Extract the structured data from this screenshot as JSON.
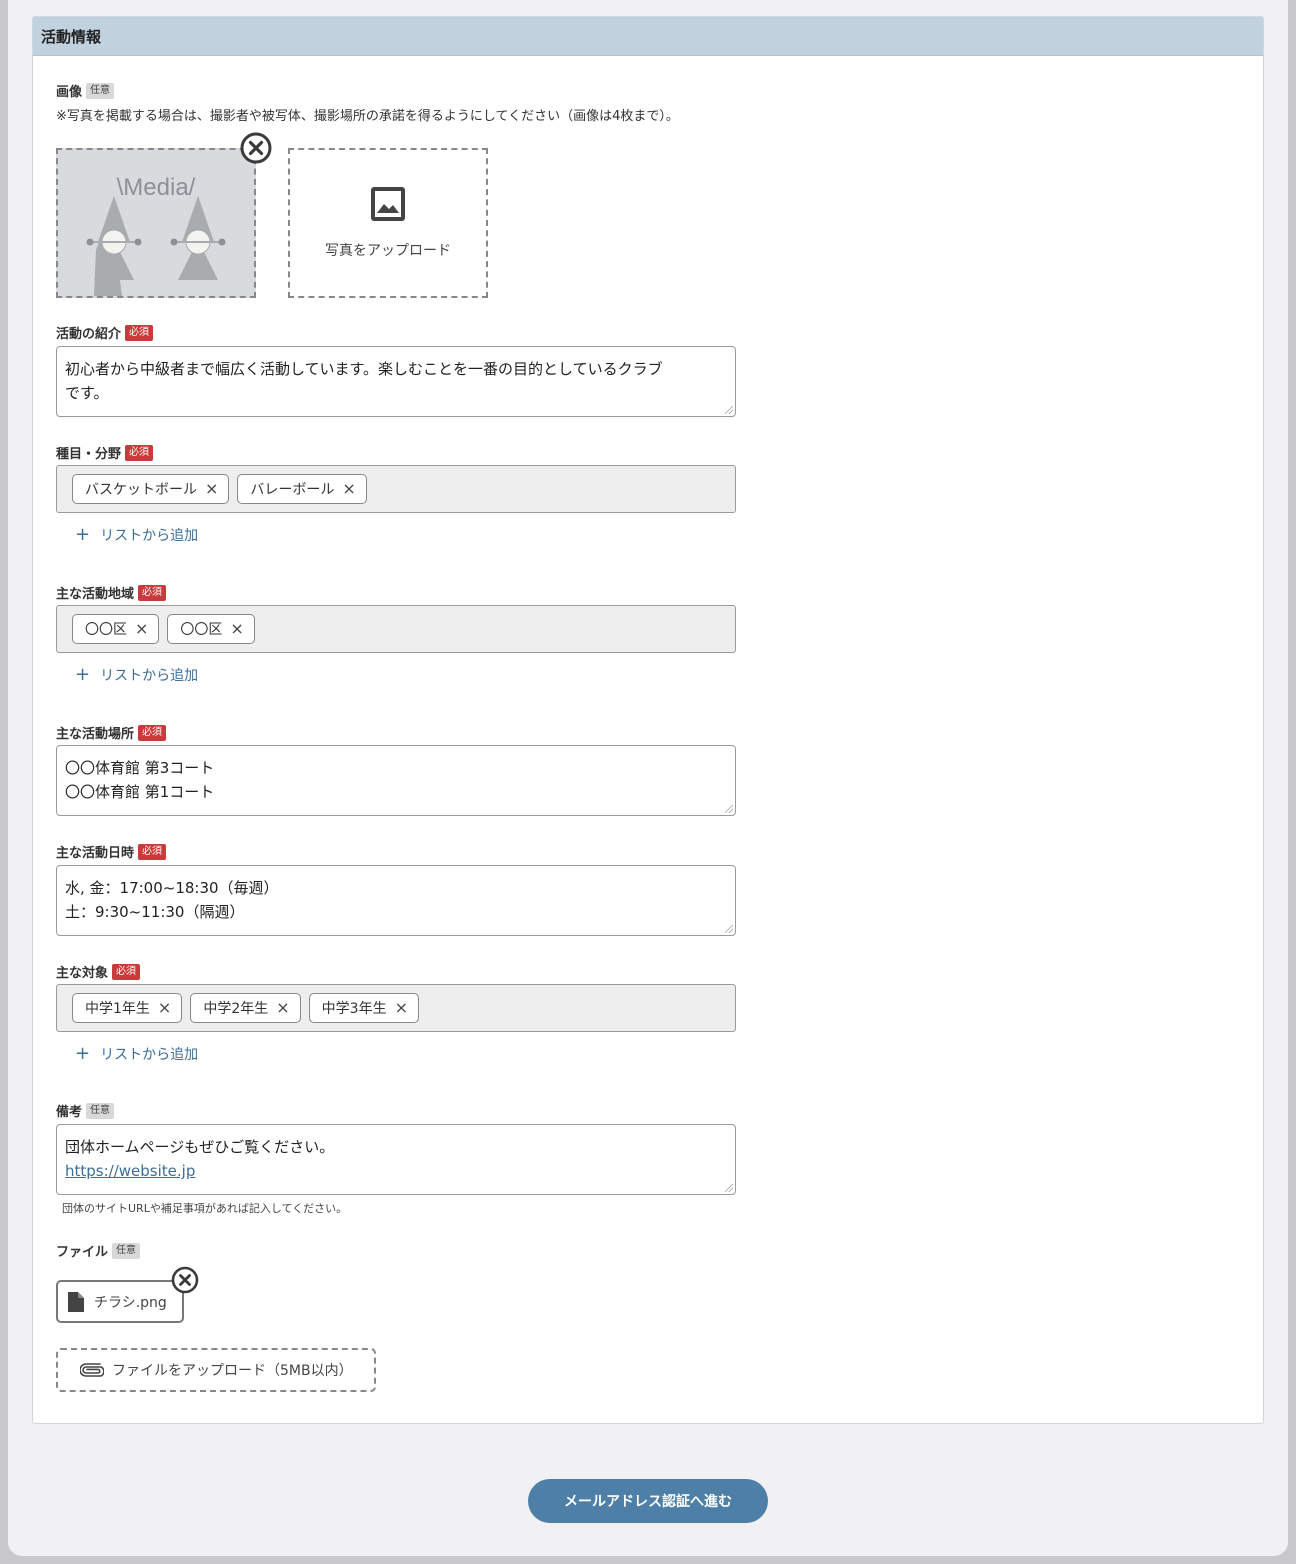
{
  "section": {
    "title": "活動情報"
  },
  "badges": {
    "optional": "任意",
    "required": "必須"
  },
  "images": {
    "label": "画像",
    "note": "※写真を掲載する場合は、撮影者や被写体、撮影場所の承諾を得るようにしてください（画像は4枚まで）。",
    "placeholder_text": "\\Media/",
    "upload_label": "写真をアップロード"
  },
  "intro": {
    "label": "活動の紹介",
    "lines": [
      "初心者から中級者まで幅広く活動しています。楽しむことを一番の目的としているクラブ",
      "です。"
    ]
  },
  "category": {
    "label": "種目・分野",
    "chips": [
      "バスケットボール",
      "バレーボール"
    ],
    "add_label": "リストから追加"
  },
  "area": {
    "label": "主な活動地域",
    "chips": [
      "〇〇区",
      "〇〇区"
    ],
    "add_label": "リストから追加"
  },
  "place": {
    "label": "主な活動場所",
    "lines": [
      "〇〇体育館 第3コート",
      "〇〇体育館 第1コート"
    ]
  },
  "schedule": {
    "label": "主な活動日時",
    "lines": [
      "水, 金：17:00~18:30（毎週）",
      "土：9:30~11:30（隔週）"
    ]
  },
  "target": {
    "label": "主な対象",
    "chips": [
      "中学1年生",
      "中学2年生",
      "中学3年生"
    ],
    "add_label": "リストから追加"
  },
  "remarks": {
    "label": "備考",
    "line1": "団体ホームページもぜひご覧ください。",
    "link": "https://website.jp",
    "help": "団体のサイトURLや補足事項があれば記入してください。"
  },
  "files": {
    "label": "ファイル",
    "file_name": "チラシ.png",
    "upload_label": "ファイルをアップロード（5MB以内）"
  },
  "submit": {
    "label": "メールアドレス認証へ進む"
  },
  "icons": {
    "chip_remove": "×",
    "add": "+"
  }
}
